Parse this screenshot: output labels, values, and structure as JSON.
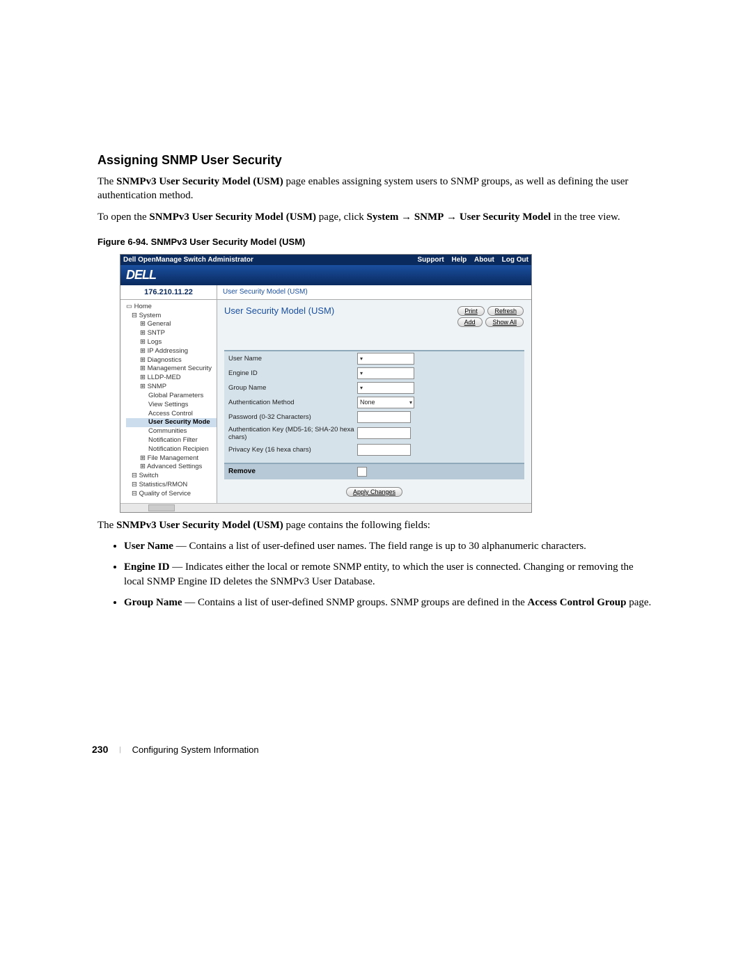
{
  "heading": "Assigning SNMP User Security",
  "para1_pre": "The ",
  "para1_b1": "SNMPv3 User Security Model (USM)",
  "para1_post": " page enables assigning system users to SNMP groups, as well as defining the user authentication method.",
  "para2_pre": "To open the ",
  "para2_b1": "SNMPv3 User Security Model (USM)",
  "para2_mid1": " page, click ",
  "para2_b2": "System",
  "para2_arrow": " → ",
  "para2_b3": "SNMP",
  "para2_b4": "User Security Model",
  "para2_post": " in the tree view.",
  "figcap": "Figure 6-94.    SNMPv3 User Security Model (USM)",
  "ss": {
    "topTitle": "Dell OpenManage Switch Administrator",
    "links": [
      "Support",
      "Help",
      "About",
      "Log Out"
    ],
    "logo": "DELL",
    "ip": "176.210.11.22",
    "crumb": "User Security Model (USM)",
    "tree": [
      {
        "lvl": 0,
        "t": "Home"
      },
      {
        "lvl": 1,
        "t": "System"
      },
      {
        "lvl": 2,
        "t": "General"
      },
      {
        "lvl": 2,
        "t": "SNTP"
      },
      {
        "lvl": 2,
        "t": "Logs"
      },
      {
        "lvl": 2,
        "t": "IP Addressing"
      },
      {
        "lvl": 2,
        "t": "Diagnostics"
      },
      {
        "lvl": 2,
        "t": "Management Security"
      },
      {
        "lvl": 2,
        "t": "LLDP-MED"
      },
      {
        "lvl": 2,
        "t": "SNMP"
      },
      {
        "lvl": 3,
        "t": "Global Parameters"
      },
      {
        "lvl": 3,
        "t": "View Settings"
      },
      {
        "lvl": 3,
        "t": "Access Control"
      },
      {
        "lvl": 3,
        "t": "User Security Mode",
        "sel": true
      },
      {
        "lvl": 3,
        "t": "Communities"
      },
      {
        "lvl": 3,
        "t": "Notification Filter"
      },
      {
        "lvl": 3,
        "t": "Notification Recipien"
      },
      {
        "lvl": 2,
        "t": "File Management"
      },
      {
        "lvl": 2,
        "t": "Advanced Settings"
      },
      {
        "lvl": 1,
        "t": "Switch"
      },
      {
        "lvl": 1,
        "t": "Statistics/RMON"
      },
      {
        "lvl": 1,
        "t": "Quality of Service"
      }
    ],
    "mainTitle": "User Security Model (USM)",
    "btns": {
      "print": "Print",
      "refresh": "Refresh",
      "add": "Add",
      "showall": "Show All"
    },
    "rows": {
      "userName": "User Name",
      "engineId": "Engine ID",
      "groupName": "Group Name",
      "authMethod": "Authentication Method",
      "authMethodVal": "None",
      "password": "Password (0-32 Characters)",
      "authKey": "Authentication Key (MD5-16; SHA-20 hexa chars)",
      "privKey": "Privacy Key (16 hexa chars)"
    },
    "remove": "Remove",
    "apply": "Apply Changes"
  },
  "followingFields_pre": "The ",
  "followingFields_b": "SNMPv3 User Security Model (USM)",
  "followingFields_post": " page contains the following fields:",
  "bullets": [
    {
      "b": "User Name",
      "t": " — Contains a list of user-defined user names. The field range is up to 30 alphanumeric characters."
    },
    {
      "b": "Engine ID",
      "t": " — Indicates either the local or remote SNMP entity, to which the user is connected. Changing or removing the local SNMP Engine ID deletes the SNMPv3 User Database."
    },
    {
      "b": "Group Name",
      "t1": " — Contains a list of user-defined SNMP groups. SNMP groups are defined in the ",
      "b2": "Access Control Group",
      "t2": " page."
    }
  ],
  "footer": {
    "page": "230",
    "chapter": "Configuring System Information"
  }
}
